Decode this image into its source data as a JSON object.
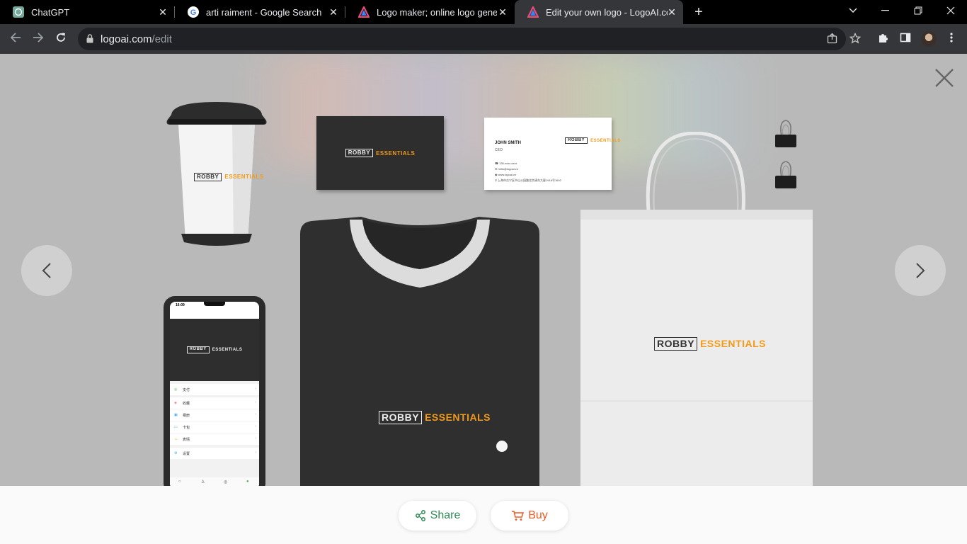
{
  "browser": {
    "tabs": [
      {
        "title": "ChatGPT",
        "icon": "chatgpt-icon",
        "active": false
      },
      {
        "title": "arti raiment - Google Search",
        "icon": "google-icon",
        "active": false
      },
      {
        "title": "Logo maker; online logo generator",
        "icon": "logoai-icon",
        "active": false
      },
      {
        "title": "Edit your own logo - LogoAI.com",
        "icon": "logoai-icon",
        "active": true
      }
    ],
    "url_host": "logoai.com",
    "url_path": "/edit"
  },
  "mockup": {
    "logo_word_boxed": "ROBBY",
    "logo_word_accent": "ESSENTIALS",
    "card": {
      "name": "JOHN SMITH",
      "role": "CEO",
      "phone": "135-xxxx-xxxx",
      "email": "hello@logoai.cn",
      "web": "www.logoai.cn",
      "address": "上海市古宁区中山公园路北京清东大厦1916号1602"
    },
    "phone_screen": {
      "time": "16:09",
      "menu_items": [
        "支付",
        "收藏",
        "相册",
        "卡包",
        "表情",
        "设置"
      ]
    }
  },
  "actions": {
    "share_label": "Share",
    "buy_label": "Buy"
  },
  "colors": {
    "accent_orange": "#f39a1a",
    "share_green": "#2e8b57",
    "buy_orange": "#f05a22"
  }
}
